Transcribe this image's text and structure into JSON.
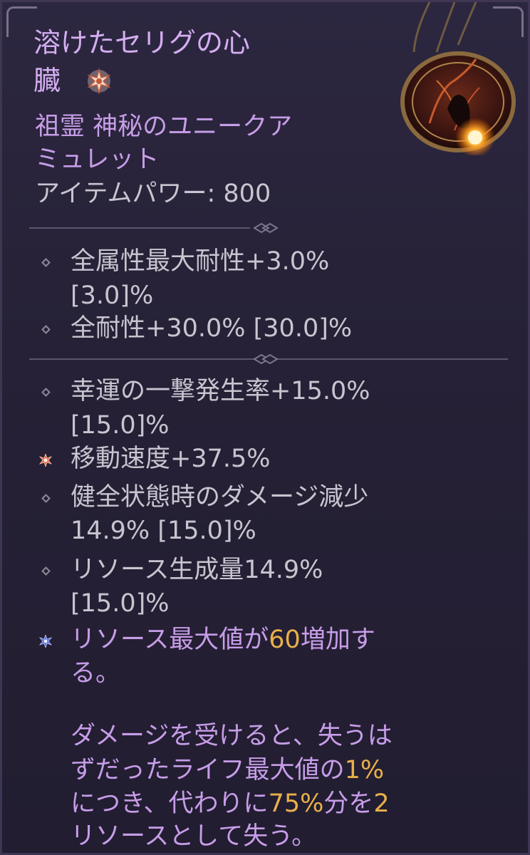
{
  "item": {
    "name_line1": "溶けたセリグの心",
    "name_line2": "臓",
    "type_line1": "祖霊 神秘のユニークア",
    "type_line2": "ミュレット",
    "power": "アイテムパワー: 800",
    "icon": "amulet-icon",
    "unique_marker_icon": "unique-star-icon"
  },
  "implicit_stats": [
    {
      "line1": "全属性最大耐性+3.0%",
      "line2": "[3.0]%"
    },
    {
      "line1": "全耐性+30.0% [30.0]%"
    }
  ],
  "affixes": [
    {
      "line1": "幸運の一撃発生率+15.0%",
      "line2": "[15.0]%"
    },
    {
      "line1": "移動速度+37.5%",
      "type": "greater-affix"
    },
    {
      "line1": "健全状態時のダメージ減少",
      "line2": "14.9% [15.0]%"
    },
    {
      "line1": "リソース生成量14.9%",
      "line2": "[15.0]%"
    }
  ],
  "unique_power": {
    "line1_pre": "リソース最大値が",
    "line1_num": "60",
    "line1_post": "増加す",
    "line2": "る。",
    "p2_line1": "ダメージを受けると、失うは",
    "p2_line2_pre": "ずだったライフ最大値の",
    "p2_line2_num": "1%",
    "p2_line3_pre": "につき、代わりに",
    "p2_line3_num": "75%",
    "p2_line3_mid": "分を",
    "p2_line3_num2": "2",
    "p2_line4": "リソースとして失う。"
  },
  "colors": {
    "title": "#d4aef0",
    "stat_text": "#c9c4cf",
    "highlight_number": "#e8b04a",
    "background": "#262136"
  }
}
